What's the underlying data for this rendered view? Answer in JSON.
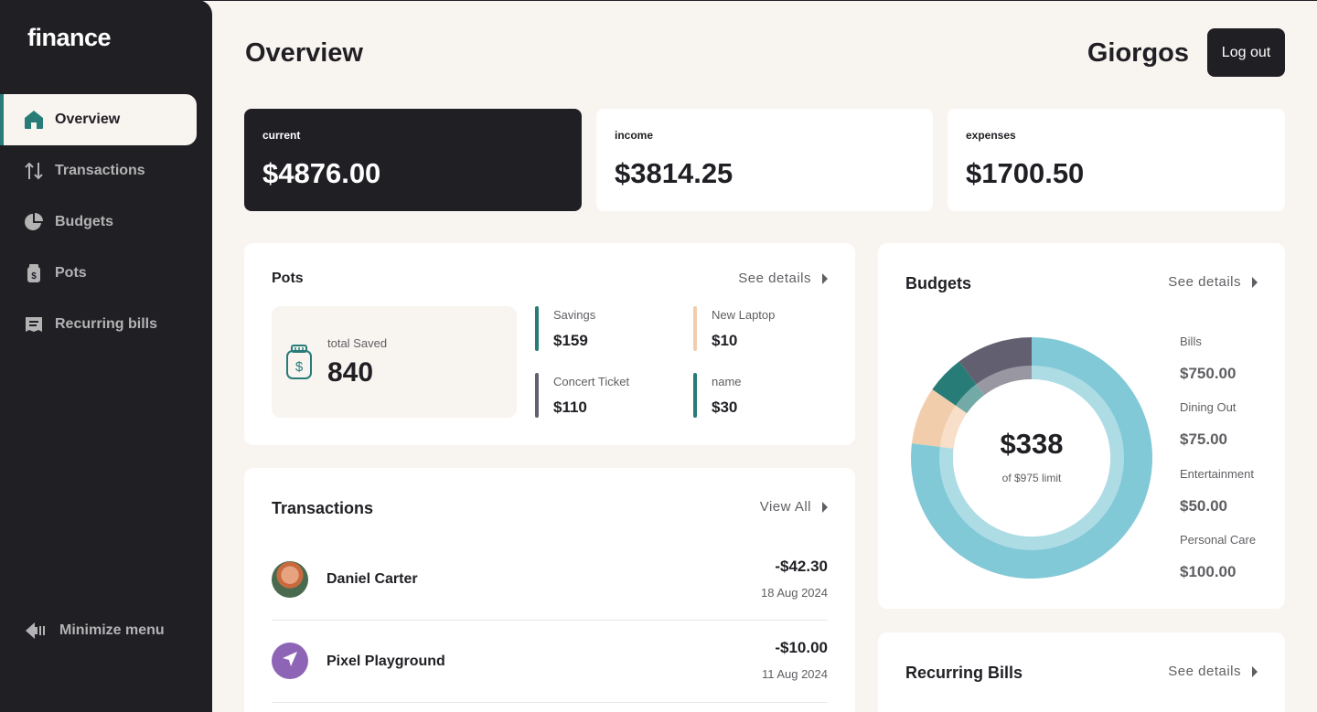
{
  "app": {
    "logo": "finance"
  },
  "sidebar": {
    "items": [
      {
        "label": "Overview",
        "icon": "home-icon"
      },
      {
        "label": "Transactions",
        "icon": "arrows-up-down-icon"
      },
      {
        "label": "Budgets",
        "icon": "pie-chart-icon"
      },
      {
        "label": "Pots",
        "icon": "jar-icon"
      },
      {
        "label": "Recurring bills",
        "icon": "receipt-icon"
      }
    ],
    "active": "Overview",
    "minimize_label": "Minimize menu"
  },
  "header": {
    "title": "Overview",
    "user": "Giorgos",
    "logout_label": "Log out"
  },
  "summary": {
    "current": {
      "label": "current",
      "value": "$4876.00"
    },
    "income": {
      "label": "income",
      "value": "$3814.25"
    },
    "expenses": {
      "label": "expenses",
      "value": "$1700.50"
    }
  },
  "pots": {
    "title": "Pots",
    "link": "See details",
    "total_label": "total Saved",
    "total_value": "840",
    "items": [
      {
        "name": "Savings",
        "amount": "$159",
        "color": "#277c78"
      },
      {
        "name": "New Laptop",
        "amount": "$10",
        "color": "#f2cdac"
      },
      {
        "name": "Concert Ticket",
        "amount": "$110",
        "color": "#626070"
      },
      {
        "name": "name",
        "amount": "$30",
        "color": "#277c78"
      }
    ]
  },
  "transactions": {
    "title": "Transactions",
    "link": "View All",
    "items": [
      {
        "name": "Daniel Carter",
        "amount": "-$42.30",
        "date": "18 Aug 2024"
      },
      {
        "name": "Pixel Playground",
        "amount": "-$10.00",
        "date": "11 Aug 2024"
      }
    ]
  },
  "budgets": {
    "title": "Budgets",
    "link": "See details",
    "spent": "$338",
    "limit_text": "of $975 limit",
    "items": [
      {
        "name": "Bills",
        "amount": "$750.00",
        "color": "#82c9d7"
      },
      {
        "name": "Dining Out",
        "amount": "$75.00",
        "color": "#f2cdac"
      },
      {
        "name": "Entertainment",
        "amount": "$50.00",
        "color": "#277c78"
      },
      {
        "name": "Personal Care",
        "amount": "$100.00",
        "color": "#626070"
      }
    ]
  },
  "recurring": {
    "title": "Recurring Bills",
    "link": "See details"
  }
}
